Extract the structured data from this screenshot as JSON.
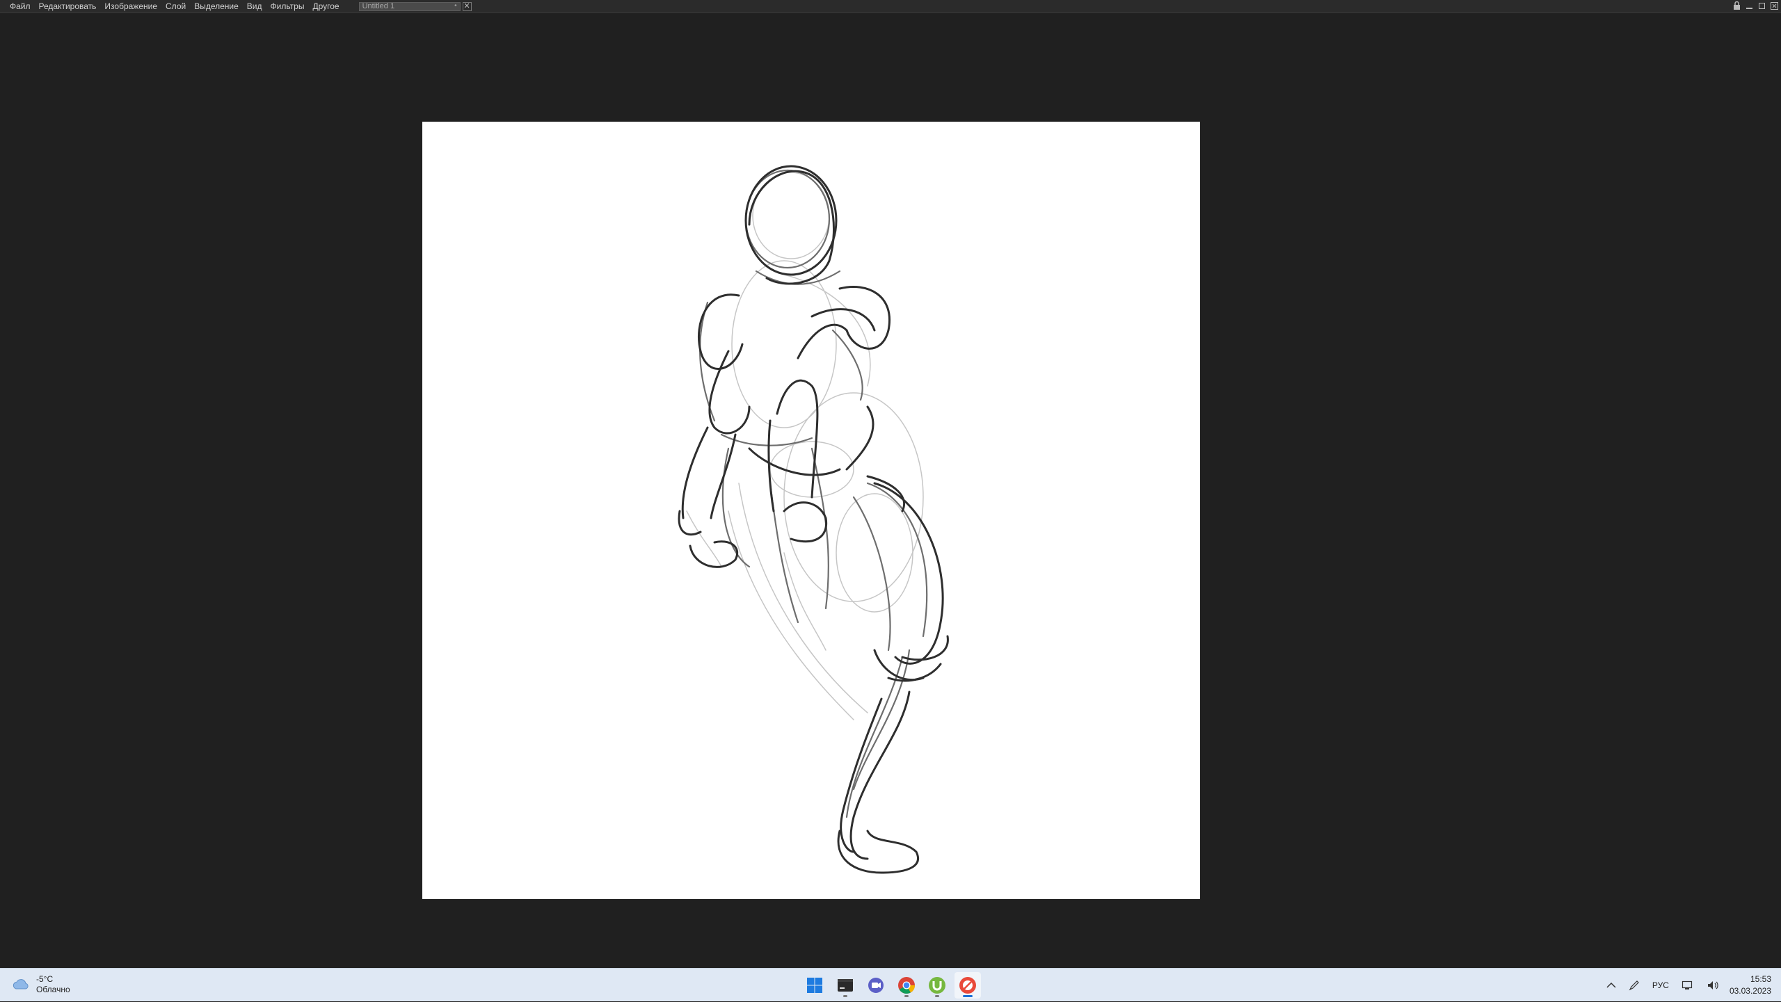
{
  "menubar": {
    "items": [
      {
        "label": "Файл"
      },
      {
        "label": "Редактировать"
      },
      {
        "label": "Изображение"
      },
      {
        "label": "Слой"
      },
      {
        "label": "Выделение"
      },
      {
        "label": "Вид"
      },
      {
        "label": "Фильтры"
      },
      {
        "label": "Другое"
      }
    ],
    "document_tab": {
      "title": "Untitled 1",
      "close_icon": "close-icon"
    },
    "window_controls": [
      "lock-icon",
      "minimize-icon",
      "maximize-icon",
      "close-icon"
    ]
  },
  "canvas": {
    "background": "#ffffff",
    "content": "pencil figure sketch"
  },
  "taskbar": {
    "weather": {
      "temperature": "-5°C",
      "condition": "Облачно",
      "icon": "cloud-icon"
    },
    "apps": [
      {
        "name": "windows-start-icon"
      },
      {
        "name": "terminal-icon"
      },
      {
        "name": "teams-chat-icon"
      },
      {
        "name": "chrome-icon"
      },
      {
        "name": "utorrent-icon"
      },
      {
        "name": "paint-app-icon",
        "active": true
      }
    ],
    "tray": {
      "chevron_icon": "chevron-up-icon",
      "pen_icon": "pen-icon",
      "language": "РУС",
      "network_icon": "network-icon",
      "volume_icon": "volume-icon",
      "time": "15:53",
      "date": "03.03.2023"
    }
  }
}
